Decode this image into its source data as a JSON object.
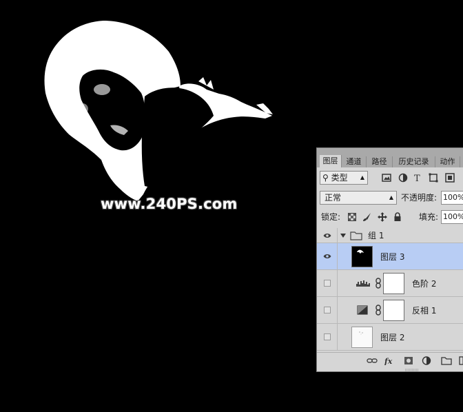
{
  "watermark": "www.240PS.com",
  "tabs": [
    "图层",
    "通道",
    "路径",
    "历史记录",
    "动作"
  ],
  "filter": {
    "kind_label": "类型",
    "icons": [
      "image-filter-icon",
      "adjustment-filter-icon",
      "type-filter-icon",
      "shape-filter-icon",
      "smart-object-filter-icon"
    ]
  },
  "blend": {
    "mode": "正常",
    "opacity_label": "不透明度:",
    "opacity_value": "100%"
  },
  "lock": {
    "label": "锁定:",
    "fill_label": "填充:",
    "fill_value": "100%",
    "icons": [
      "lock-transparent-icon",
      "lock-paint-icon",
      "lock-move-icon",
      "lock-all-icon"
    ]
  },
  "layers": [
    {
      "name": "组 1",
      "type": "group",
      "visible": true,
      "selected": false
    },
    {
      "name": "图层 3",
      "type": "pixel",
      "visible": true,
      "selected": true
    },
    {
      "name": "色阶 2",
      "type": "levels",
      "visible": false,
      "selected": false
    },
    {
      "name": "反相 1",
      "type": "invert",
      "visible": false,
      "selected": false
    },
    {
      "name": "图层 2",
      "type": "pixel",
      "visible": false,
      "selected": false
    }
  ],
  "bottom_icons": [
    "link-layers-icon",
    "fx-icon",
    "add-mask-icon",
    "new-adjustment-icon",
    "new-group-icon",
    "new-layer-icon"
  ],
  "colors": {
    "selection": "#b8cdf4",
    "panel": "#d6d6d6",
    "tabbar": "#a9a9a9"
  }
}
